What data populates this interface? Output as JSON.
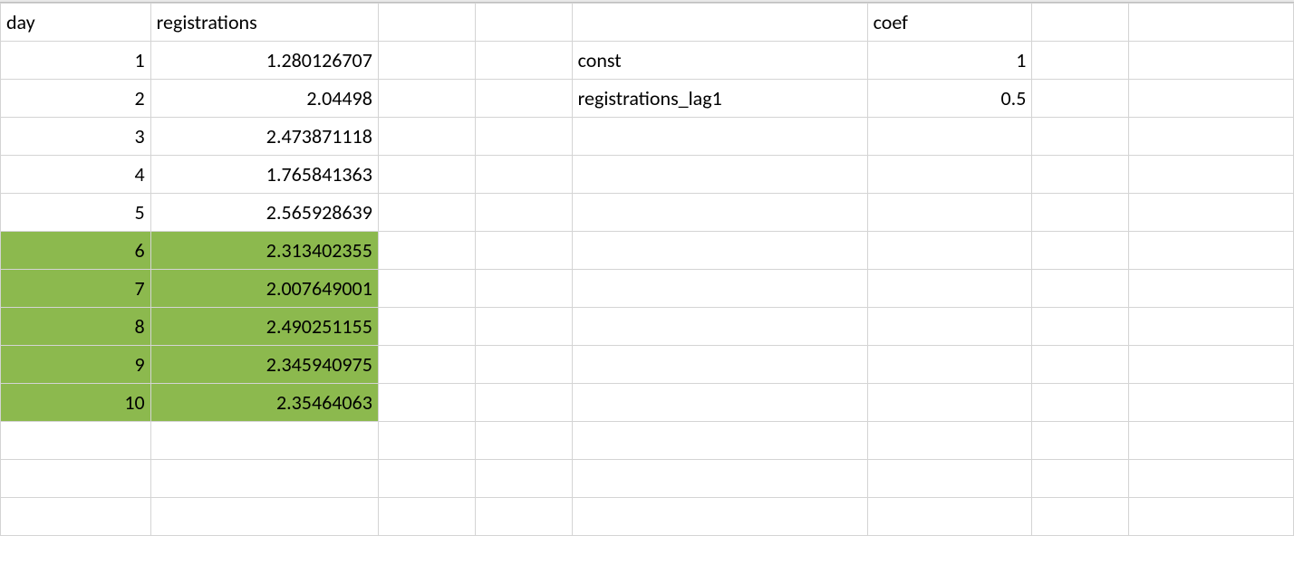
{
  "headers": {
    "day": "day",
    "registrations": "registrations",
    "coef": "coef"
  },
  "data_rows": [
    {
      "day": "1",
      "reg": "1.280126707",
      "hl": false
    },
    {
      "day": "2",
      "reg": "2.04498",
      "hl": false
    },
    {
      "day": "3",
      "reg": "2.473871118",
      "hl": false
    },
    {
      "day": "4",
      "reg": "1.765841363",
      "hl": false
    },
    {
      "day": "5",
      "reg": "2.565928639",
      "hl": false
    },
    {
      "day": "6",
      "reg": "2.313402355",
      "hl": true
    },
    {
      "day": "7",
      "reg": "2.007649001",
      "hl": true
    },
    {
      "day": "8",
      "reg": "2.490251155",
      "hl": true
    },
    {
      "day": "9",
      "reg": "2.345940975",
      "hl": true
    },
    {
      "day": "10",
      "reg": "2.35464063",
      "hl": true
    }
  ],
  "coef_rows": [
    {
      "label": "const",
      "val": "1"
    },
    {
      "label": "registrations_lag1",
      "val": "0.5"
    }
  ],
  "colors": {
    "highlight": "#8cb94e",
    "grid": "#d4d4d4"
  }
}
